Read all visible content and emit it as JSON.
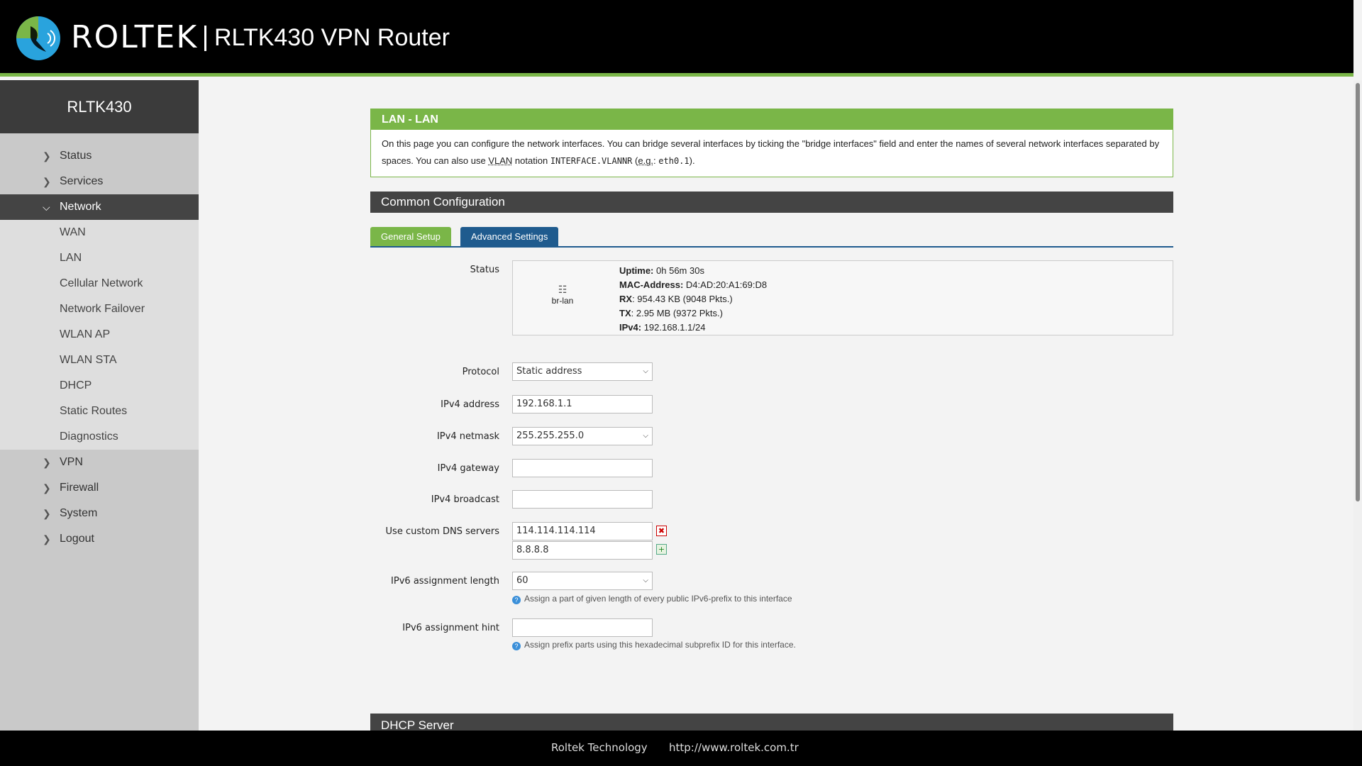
{
  "header": {
    "brand": "ROLTEK",
    "product": "RLTK430 VPN Router"
  },
  "sidebar": {
    "title": "RLTK430",
    "items": [
      {
        "label": "Status"
      },
      {
        "label": "Services"
      },
      {
        "label": "Network"
      },
      {
        "label": "VPN"
      },
      {
        "label": "Firewall"
      },
      {
        "label": "System"
      },
      {
        "label": "Logout"
      }
    ],
    "network_sub": [
      {
        "label": "WAN"
      },
      {
        "label": "LAN"
      },
      {
        "label": "Cellular Network"
      },
      {
        "label": "Network Failover"
      },
      {
        "label": "WLAN AP"
      },
      {
        "label": "WLAN STA"
      },
      {
        "label": "DHCP"
      },
      {
        "label": "Static Routes"
      },
      {
        "label": "Diagnostics"
      }
    ]
  },
  "page": {
    "title": "LAN - LAN",
    "desc_part1": "On this page you can configure the network interfaces. You can bridge several interfaces by ticking the \"bridge interfaces\" field and enter the names of several network interfaces separated by spaces. You can also use ",
    "desc_vlan": "VLAN",
    "desc_part2": " notation ",
    "desc_code1": "INTERFACE.VLANNR",
    "desc_part3": " (",
    "desc_eg": "e.g.",
    "desc_part4": ": ",
    "desc_code2": "eth0.1",
    "desc_part5": ").",
    "section_title": "Common Configuration",
    "tabs": {
      "general": "General Setup",
      "advanced": "Advanced Settings"
    }
  },
  "status": {
    "label": "Status",
    "iface": "br-lan",
    "uptime_label": "Uptime:",
    "uptime": "0h 56m 30s",
    "mac_label": "MAC-Address:",
    "mac": "D4:AD:20:A1:69:D8",
    "rx_label": "RX",
    "rx": ": 954.43 KB (9048 Pkts.)",
    "tx_label": "TX",
    "tx": ": 2.95 MB (9372 Pkts.)",
    "ipv4_label": "IPv4:",
    "ipv4": "192.168.1.1/24"
  },
  "form": {
    "protocol_label": "Protocol",
    "protocol": "Static address",
    "ipv4_addr_label": "IPv4 address",
    "ipv4_addr": "192.168.1.1",
    "netmask_label": "IPv4 netmask",
    "netmask": "255.255.255.0",
    "gateway_label": "IPv4 gateway",
    "gateway": "",
    "broadcast_label": "IPv4 broadcast",
    "broadcast": "",
    "dns_label": "Use custom DNS servers",
    "dns1": "114.114.114.114",
    "dns2": "8.8.8.8",
    "ipv6_len_label": "IPv6 assignment length",
    "ipv6_len": "60",
    "ipv6_len_hint": "Assign a part of given length of every public IPv6-prefix to this interface",
    "ipv6_hint_label": "IPv6 assignment hint",
    "ipv6_hint": "",
    "ipv6_hint_hint": "Assign prefix parts using this hexadecimal subprefix ID for this interface."
  },
  "dhcp": {
    "title": "DHCP Server"
  },
  "footer": {
    "company": "Roltek Technology",
    "url": "http://www.roltek.com.tr"
  },
  "colors": {
    "accent_green": "#7ab648",
    "accent_blue": "#1f5b8e",
    "dark": "#444444"
  }
}
